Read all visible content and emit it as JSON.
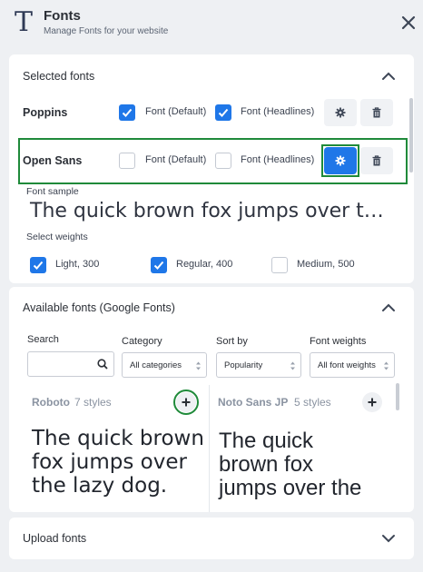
{
  "header": {
    "title": "Fonts",
    "subtitle": "Manage Fonts for your website",
    "icon": "T"
  },
  "selected": {
    "title": "Selected fonts",
    "rows": [
      {
        "name": "Poppins",
        "default_label": "Font (Default)",
        "default_checked": true,
        "headlines_label": "Font (Headlines)",
        "headlines_checked": true
      },
      {
        "name": "Open Sans",
        "default_label": "Font (Default)",
        "default_checked": false,
        "headlines_label": "Font (Headlines)",
        "headlines_checked": false
      }
    ],
    "sample_label": "Font sample",
    "sample_text": "The quick brown fox jumps over t…",
    "weights_label": "Select weights",
    "weights": [
      {
        "label": "Light, 300",
        "checked": true
      },
      {
        "label": "Regular, 400",
        "checked": true
      },
      {
        "label": "Medium, 500",
        "checked": false
      }
    ]
  },
  "available": {
    "title": "Available fonts (Google Fonts)",
    "search_label": "Search",
    "search_value": "",
    "category_label": "Category",
    "category_value": "All categories",
    "sort_label": "Sort by",
    "sort_value": "Popularity",
    "weights_label": "Font weights",
    "weights_value": "All font weights",
    "fonts": [
      {
        "name": "Roboto",
        "styles": "7 styles",
        "sample": [
          "The quick brown",
          "fox jumps over",
          "the lazy dog."
        ]
      },
      {
        "name": "Noto Sans JP",
        "styles": "5 styles",
        "sample": [
          "The quick",
          "brown fox",
          "jumps over the"
        ]
      }
    ]
  },
  "upload": {
    "title": "Upload fonts"
  },
  "colors": {
    "accent": "#1f77e8",
    "highlight": "#1f8a3a"
  }
}
